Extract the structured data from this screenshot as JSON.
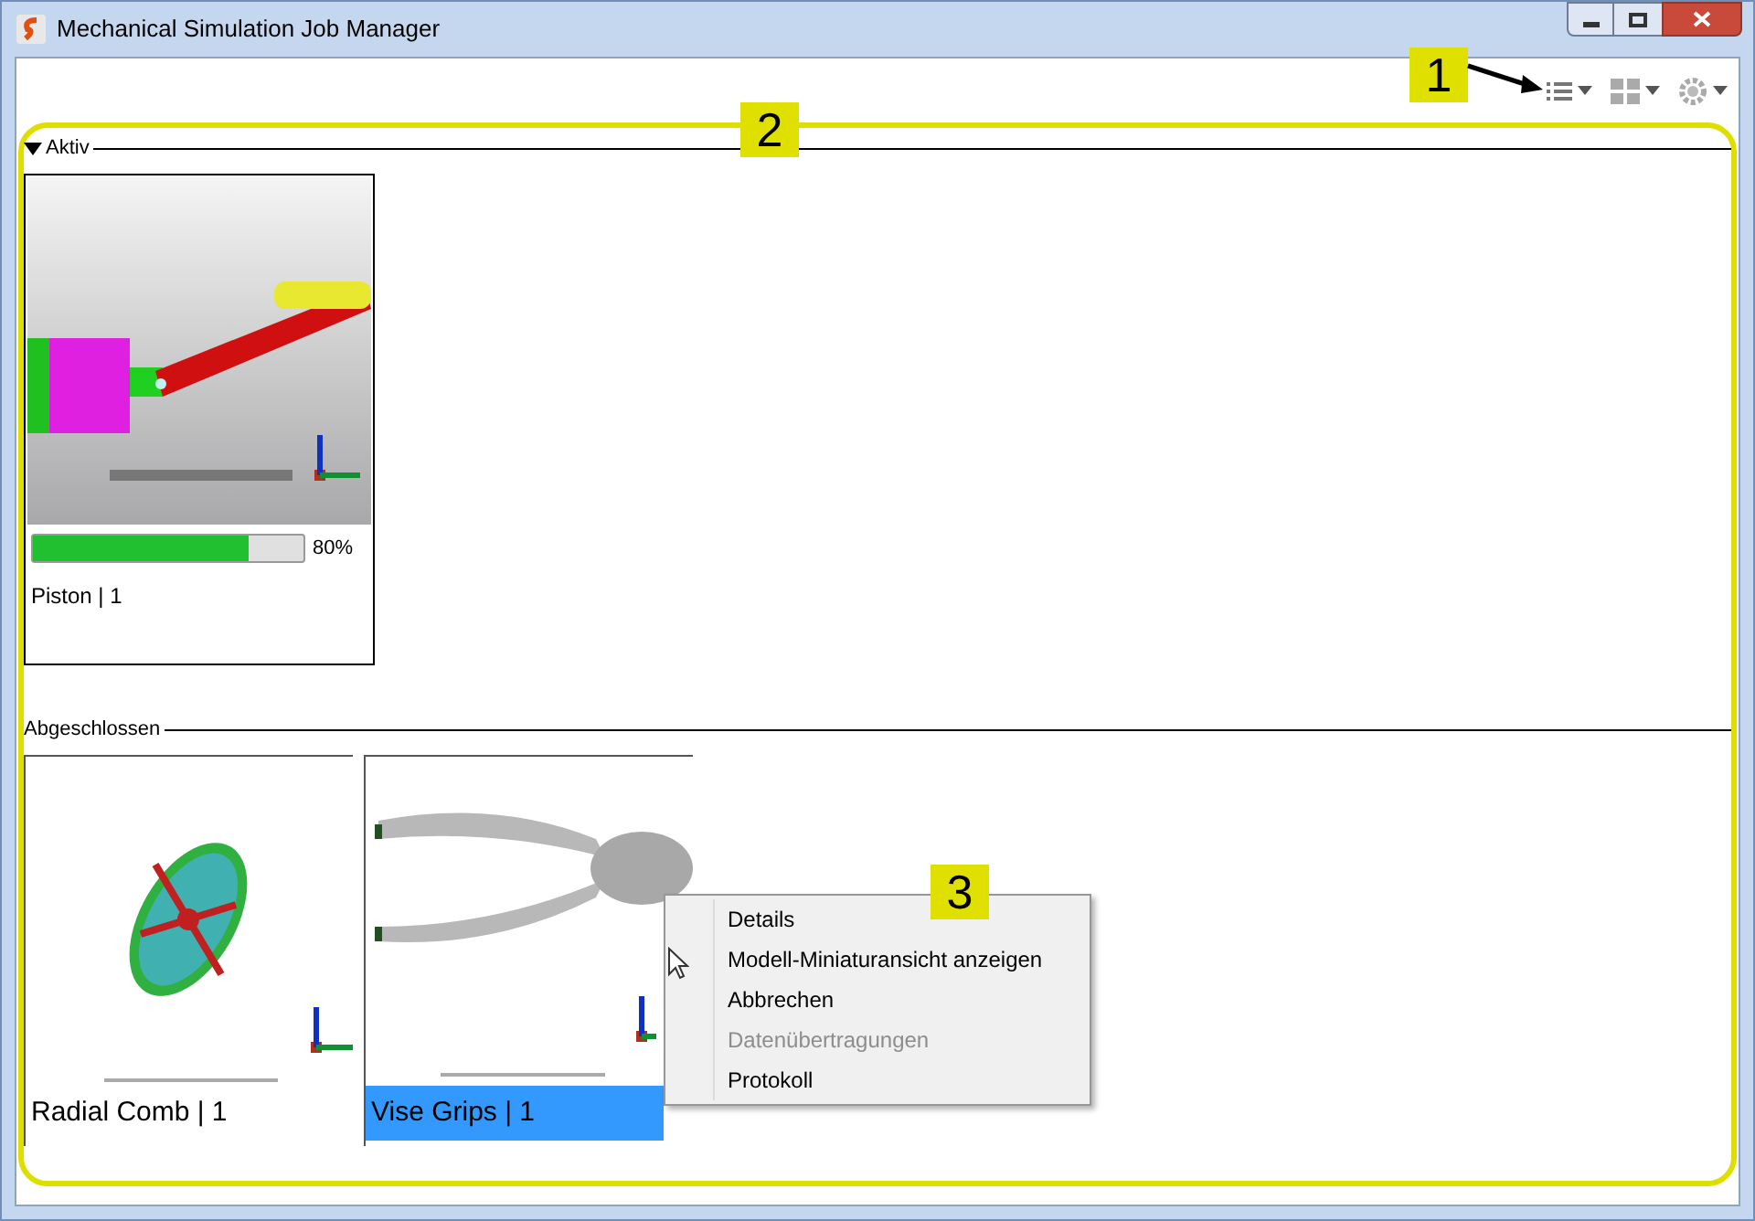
{
  "window": {
    "title": "Mechanical Simulation Job Manager"
  },
  "callouts": [
    "1",
    "2",
    "3"
  ],
  "sections": [
    {
      "title": "Aktiv",
      "expanded": true,
      "jobs": [
        {
          "kind": "piston",
          "name": "Piston | 1",
          "selected": false,
          "progress": {
            "level": 0.8,
            "reading": "80%"
          }
        }
      ]
    },
    {
      "title": "Abgeschlossen",
      "jobs": [
        {
          "kind": "disc",
          "name": "Radial Comb | 1",
          "selected": false
        },
        {
          "kind": "pliers",
          "name": "Vise Grips | 1",
          "selected": true
        }
      ]
    }
  ],
  "context_menu": {
    "items": [
      {
        "label": "Details",
        "disabled": false
      },
      {
        "label": "Modell-Miniaturansicht anzeigen",
        "disabled": false
      },
      {
        "label": "Abbrechen",
        "disabled": false
      },
      {
        "label": "Datenübertragungen",
        "disabled": true
      },
      {
        "label": "Protokoll",
        "disabled": false
      }
    ]
  }
}
